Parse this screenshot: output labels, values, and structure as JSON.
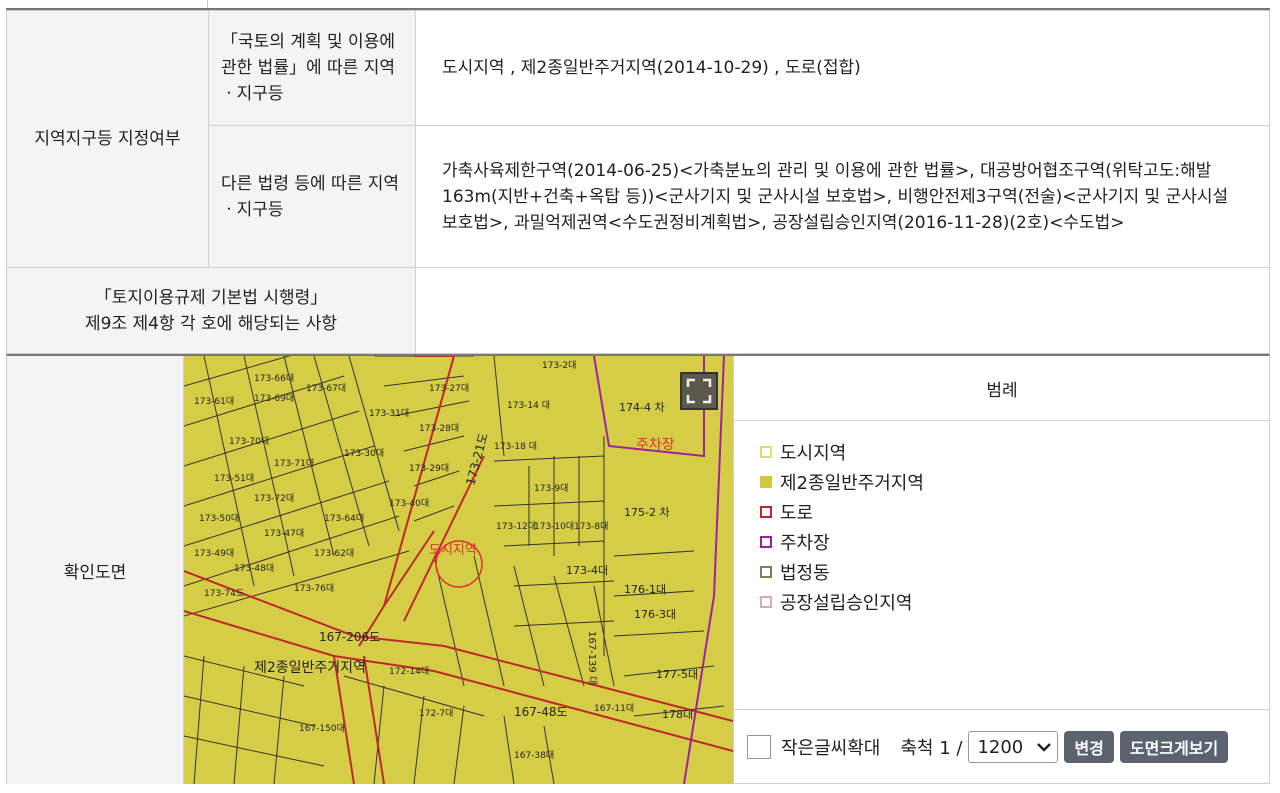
{
  "row1": {
    "header": "지역지구등 지정여부",
    "sub1": "「국토의 계획 및 이용에 관한 법률」에 따른 지역ㆍ지구등",
    "val1": "도시지역 , 제2종일반주거지역(2014-10-29) , 도로(접합)",
    "sub2": "다른 법령 등에 따른 지역ㆍ지구등",
    "val2": "가축사육제한구역(2014-06-25)<가축분뇨의 관리 및 이용에 관한 법률>, 대공방어협조구역(위탁고도:해발163m(지반+건축+옥탑 등))<군사기지 및 군사시설 보호법>, 비행안전제3구역(전술)<군사기지 및 군사시설 보호법>, 과밀억제권역<수도권정비계획법>, 공장설립승인지역(2016-11-28)(2호)<수도법>"
  },
  "row2": {
    "header_line1": "「토지이용규제 기본법 시행령」",
    "header_line2": "제9조 제4항 각 호에 해당되는 사항",
    "value": ""
  },
  "confirm": {
    "label": "확인도면"
  },
  "map": {
    "labels": {
      "city_area": "도시지역",
      "parking": "주차장",
      "zone2": "제2종일반주거지역",
      "road_a": "167-206도",
      "road_b": "167-48도",
      "road_c": "173-21도",
      "p1": "174-4 차",
      "p2": "175-2 차",
      "p3": "176-1대",
      "p4": "176-3대",
      "p5": "177-5대",
      "p6": "173-4대",
      "p7": "173-18 대",
      "p8": "173-9대",
      "p9": "173-12대",
      "p10": "173-10대",
      "p11": "173-8대",
      "p12": "173-14 대",
      "p13": "173-2대",
      "p14": "167-139 대",
      "p15": "173-61대",
      "p16": "173-66대",
      "p17": "173-67대",
      "p18": "173-70대",
      "p19": "173-69대",
      "p20": "173-31대",
      "p21": "173-27대",
      "p22": "173-28대",
      "p23": "173-29대",
      "p24": "173-30대",
      "p25": "173-40대",
      "p26": "173-71대",
      "p27": "173-72대",
      "p28": "173-51대",
      "p29": "173-50대",
      "p30": "173-49대",
      "p31": "173-48대",
      "p32": "173-47대",
      "p33": "173-64대",
      "p34": "173-62대",
      "p35": "173-76대",
      "p36": "173-74도",
      "p37": "172-14대",
      "p38": "172-7대",
      "p39": "167-38대",
      "p40": "167-11대",
      "p41": "178대",
      "p42": "167-150대"
    }
  },
  "legend": {
    "title": "범례",
    "items": [
      {
        "label": "도시지역",
        "color": "#e0d870",
        "fill": "none"
      },
      {
        "label": "제2종일반주거지역",
        "color": "#cfc93a",
        "fill": "#cfc93a"
      },
      {
        "label": "도로",
        "color": "#c0272d",
        "fill": "none"
      },
      {
        "label": "주차장",
        "color": "#a020a0",
        "fill": "none"
      },
      {
        "label": "법정동",
        "color": "#8a7a5a",
        "fill": "none"
      },
      {
        "label": "공장설립승인지역",
        "color": "#e0a0c8",
        "fill": "none"
      }
    ]
  },
  "controls": {
    "small_font_label": "작은글씨확대",
    "scale_label": "축척 1 /",
    "scale_value": "1200",
    "change_button": "변경",
    "large_view_button": "도면크게보기"
  }
}
